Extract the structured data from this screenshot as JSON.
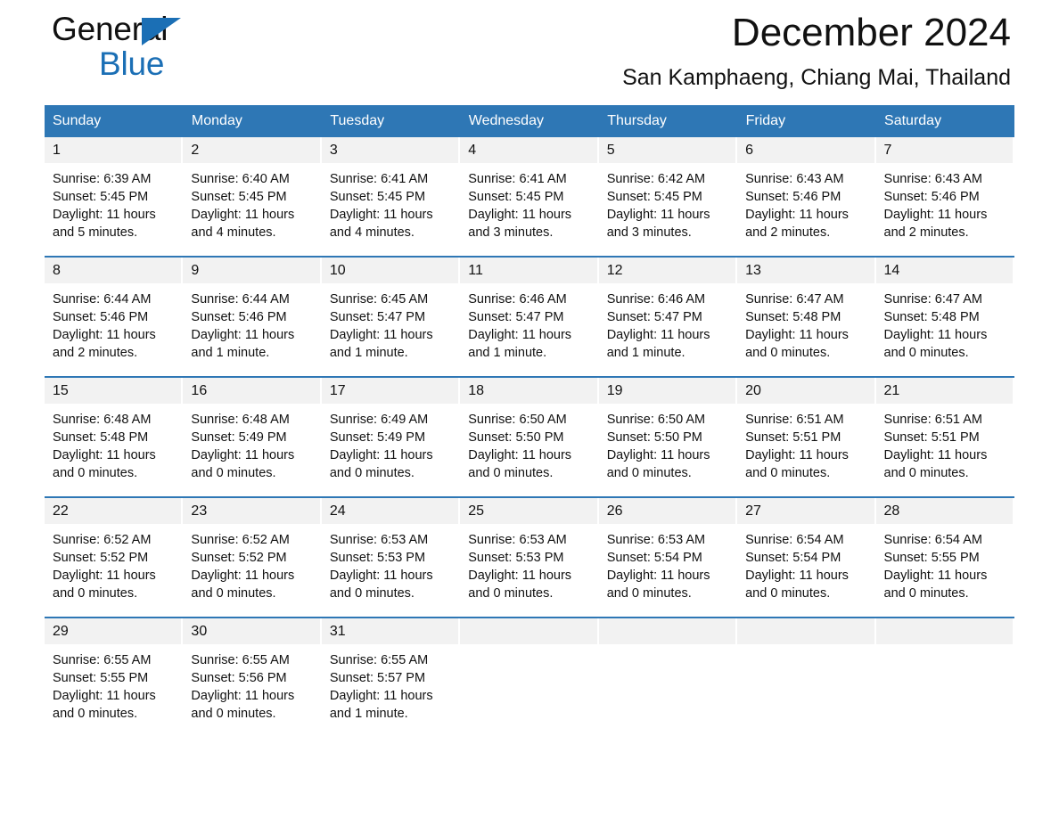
{
  "brand": {
    "name_part1": "General",
    "name_part2": "Blue",
    "triangle_color": "#1b6fb5"
  },
  "header": {
    "month_title": "December 2024",
    "location": "San Kamphaeng, Chiang Mai, Thailand",
    "accent_color": "#2e77b5",
    "daynum_band_color": "#f2f2f2"
  },
  "weekday_headers": [
    "Sunday",
    "Monday",
    "Tuesday",
    "Wednesday",
    "Thursday",
    "Friday",
    "Saturday"
  ],
  "weeks": [
    [
      {
        "day": "1",
        "sunrise": "Sunrise: 6:39 AM",
        "sunset": "Sunset: 5:45 PM",
        "daylight_line1": "Daylight: 11 hours",
        "daylight_line2": "and 5 minutes."
      },
      {
        "day": "2",
        "sunrise": "Sunrise: 6:40 AM",
        "sunset": "Sunset: 5:45 PM",
        "daylight_line1": "Daylight: 11 hours",
        "daylight_line2": "and 4 minutes."
      },
      {
        "day": "3",
        "sunrise": "Sunrise: 6:41 AM",
        "sunset": "Sunset: 5:45 PM",
        "daylight_line1": "Daylight: 11 hours",
        "daylight_line2": "and 4 minutes."
      },
      {
        "day": "4",
        "sunrise": "Sunrise: 6:41 AM",
        "sunset": "Sunset: 5:45 PM",
        "daylight_line1": "Daylight: 11 hours",
        "daylight_line2": "and 3 minutes."
      },
      {
        "day": "5",
        "sunrise": "Sunrise: 6:42 AM",
        "sunset": "Sunset: 5:45 PM",
        "daylight_line1": "Daylight: 11 hours",
        "daylight_line2": "and 3 minutes."
      },
      {
        "day": "6",
        "sunrise": "Sunrise: 6:43 AM",
        "sunset": "Sunset: 5:46 PM",
        "daylight_line1": "Daylight: 11 hours",
        "daylight_line2": "and 2 minutes."
      },
      {
        "day": "7",
        "sunrise": "Sunrise: 6:43 AM",
        "sunset": "Sunset: 5:46 PM",
        "daylight_line1": "Daylight: 11 hours",
        "daylight_line2": "and 2 minutes."
      }
    ],
    [
      {
        "day": "8",
        "sunrise": "Sunrise: 6:44 AM",
        "sunset": "Sunset: 5:46 PM",
        "daylight_line1": "Daylight: 11 hours",
        "daylight_line2": "and 2 minutes."
      },
      {
        "day": "9",
        "sunrise": "Sunrise: 6:44 AM",
        "sunset": "Sunset: 5:46 PM",
        "daylight_line1": "Daylight: 11 hours",
        "daylight_line2": "and 1 minute."
      },
      {
        "day": "10",
        "sunrise": "Sunrise: 6:45 AM",
        "sunset": "Sunset: 5:47 PM",
        "daylight_line1": "Daylight: 11 hours",
        "daylight_line2": "and 1 minute."
      },
      {
        "day": "11",
        "sunrise": "Sunrise: 6:46 AM",
        "sunset": "Sunset: 5:47 PM",
        "daylight_line1": "Daylight: 11 hours",
        "daylight_line2": "and 1 minute."
      },
      {
        "day": "12",
        "sunrise": "Sunrise: 6:46 AM",
        "sunset": "Sunset: 5:47 PM",
        "daylight_line1": "Daylight: 11 hours",
        "daylight_line2": "and 1 minute."
      },
      {
        "day": "13",
        "sunrise": "Sunrise: 6:47 AM",
        "sunset": "Sunset: 5:48 PM",
        "daylight_line1": "Daylight: 11 hours",
        "daylight_line2": "and 0 minutes."
      },
      {
        "day": "14",
        "sunrise": "Sunrise: 6:47 AM",
        "sunset": "Sunset: 5:48 PM",
        "daylight_line1": "Daylight: 11 hours",
        "daylight_line2": "and 0 minutes."
      }
    ],
    [
      {
        "day": "15",
        "sunrise": "Sunrise: 6:48 AM",
        "sunset": "Sunset: 5:48 PM",
        "daylight_line1": "Daylight: 11 hours",
        "daylight_line2": "and 0 minutes."
      },
      {
        "day": "16",
        "sunrise": "Sunrise: 6:48 AM",
        "sunset": "Sunset: 5:49 PM",
        "daylight_line1": "Daylight: 11 hours",
        "daylight_line2": "and 0 minutes."
      },
      {
        "day": "17",
        "sunrise": "Sunrise: 6:49 AM",
        "sunset": "Sunset: 5:49 PM",
        "daylight_line1": "Daylight: 11 hours",
        "daylight_line2": "and 0 minutes."
      },
      {
        "day": "18",
        "sunrise": "Sunrise: 6:50 AM",
        "sunset": "Sunset: 5:50 PM",
        "daylight_line1": "Daylight: 11 hours",
        "daylight_line2": "and 0 minutes."
      },
      {
        "day": "19",
        "sunrise": "Sunrise: 6:50 AM",
        "sunset": "Sunset: 5:50 PM",
        "daylight_line1": "Daylight: 11 hours",
        "daylight_line2": "and 0 minutes."
      },
      {
        "day": "20",
        "sunrise": "Sunrise: 6:51 AM",
        "sunset": "Sunset: 5:51 PM",
        "daylight_line1": "Daylight: 11 hours",
        "daylight_line2": "and 0 minutes."
      },
      {
        "day": "21",
        "sunrise": "Sunrise: 6:51 AM",
        "sunset": "Sunset: 5:51 PM",
        "daylight_line1": "Daylight: 11 hours",
        "daylight_line2": "and 0 minutes."
      }
    ],
    [
      {
        "day": "22",
        "sunrise": "Sunrise: 6:52 AM",
        "sunset": "Sunset: 5:52 PM",
        "daylight_line1": "Daylight: 11 hours",
        "daylight_line2": "and 0 minutes."
      },
      {
        "day": "23",
        "sunrise": "Sunrise: 6:52 AM",
        "sunset": "Sunset: 5:52 PM",
        "daylight_line1": "Daylight: 11 hours",
        "daylight_line2": "and 0 minutes."
      },
      {
        "day": "24",
        "sunrise": "Sunrise: 6:53 AM",
        "sunset": "Sunset: 5:53 PM",
        "daylight_line1": "Daylight: 11 hours",
        "daylight_line2": "and 0 minutes."
      },
      {
        "day": "25",
        "sunrise": "Sunrise: 6:53 AM",
        "sunset": "Sunset: 5:53 PM",
        "daylight_line1": "Daylight: 11 hours",
        "daylight_line2": "and 0 minutes."
      },
      {
        "day": "26",
        "sunrise": "Sunrise: 6:53 AM",
        "sunset": "Sunset: 5:54 PM",
        "daylight_line1": "Daylight: 11 hours",
        "daylight_line2": "and 0 minutes."
      },
      {
        "day": "27",
        "sunrise": "Sunrise: 6:54 AM",
        "sunset": "Sunset: 5:54 PM",
        "daylight_line1": "Daylight: 11 hours",
        "daylight_line2": "and 0 minutes."
      },
      {
        "day": "28",
        "sunrise": "Sunrise: 6:54 AM",
        "sunset": "Sunset: 5:55 PM",
        "daylight_line1": "Daylight: 11 hours",
        "daylight_line2": "and 0 minutes."
      }
    ],
    [
      {
        "day": "29",
        "sunrise": "Sunrise: 6:55 AM",
        "sunset": "Sunset: 5:55 PM",
        "daylight_line1": "Daylight: 11 hours",
        "daylight_line2": "and 0 minutes."
      },
      {
        "day": "30",
        "sunrise": "Sunrise: 6:55 AM",
        "sunset": "Sunset: 5:56 PM",
        "daylight_line1": "Daylight: 11 hours",
        "daylight_line2": "and 0 minutes."
      },
      {
        "day": "31",
        "sunrise": "Sunrise: 6:55 AM",
        "sunset": "Sunset: 5:57 PM",
        "daylight_line1": "Daylight: 11 hours",
        "daylight_line2": "and 1 minute."
      },
      {
        "day": "",
        "sunrise": "",
        "sunset": "",
        "daylight_line1": "",
        "daylight_line2": ""
      },
      {
        "day": "",
        "sunrise": "",
        "sunset": "",
        "daylight_line1": "",
        "daylight_line2": ""
      },
      {
        "day": "",
        "sunrise": "",
        "sunset": "",
        "daylight_line1": "",
        "daylight_line2": ""
      },
      {
        "day": "",
        "sunrise": "",
        "sunset": "",
        "daylight_line1": "",
        "daylight_line2": ""
      }
    ]
  ]
}
